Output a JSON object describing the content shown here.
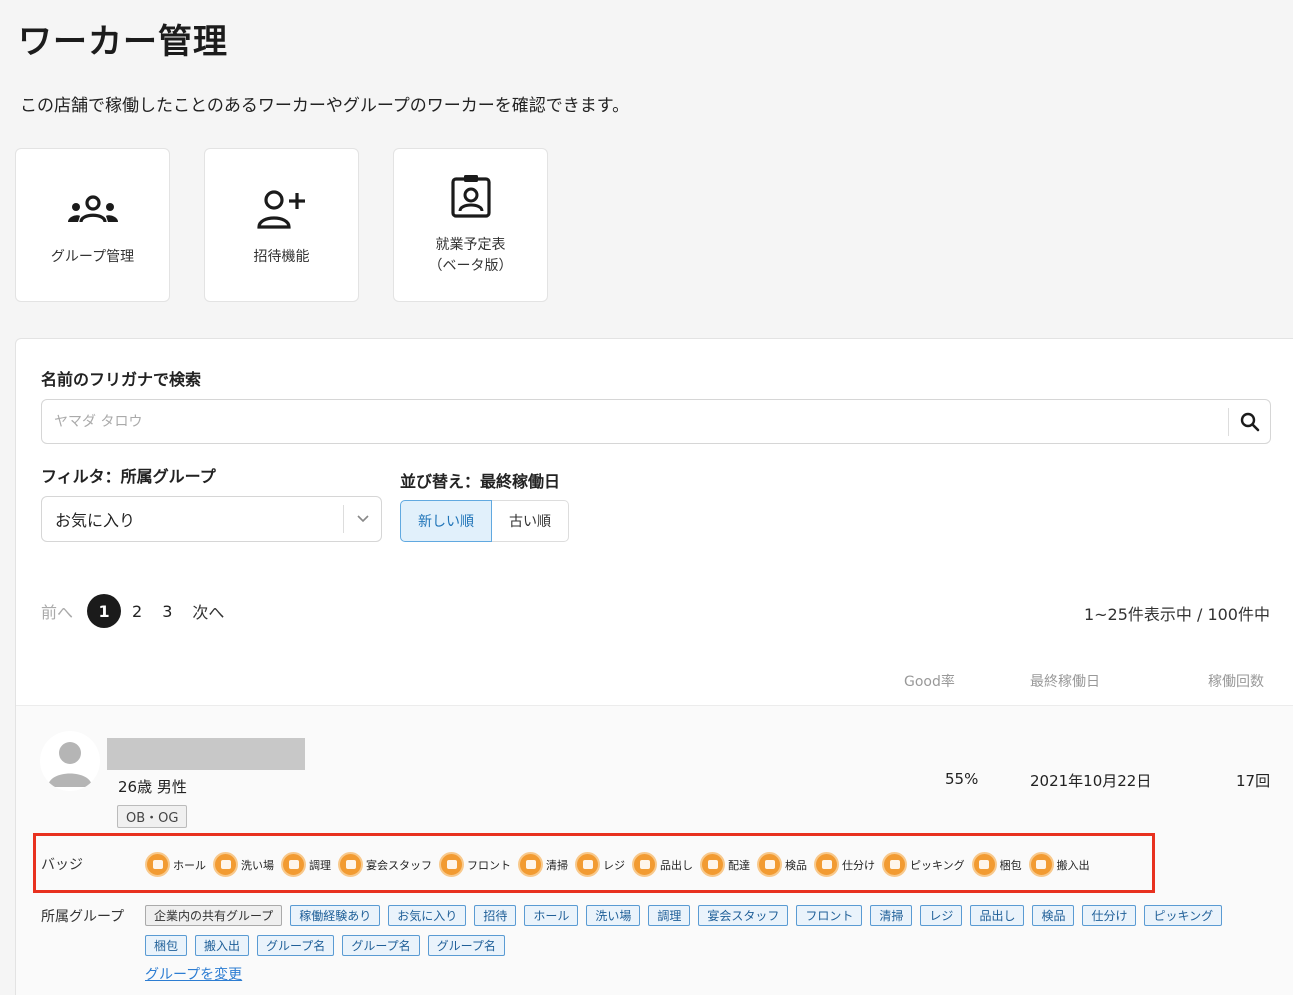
{
  "header": {
    "title": "ワーカー管理",
    "description": "この店舗で稼働したことのあるワーカーやグループのワーカーを確認できます。"
  },
  "cards": [
    {
      "label": "グループ管理",
      "icon": "group-icon"
    },
    {
      "label": "招待機能",
      "icon": "user-plus-icon"
    },
    {
      "label_line1": "就業予定表",
      "label_line2": "（ベータ版）",
      "icon": "id-badge-icon"
    }
  ],
  "search": {
    "label": "名前のフリガナで検索",
    "placeholder": "ヤマダ タロウ",
    "value": ""
  },
  "filter": {
    "label": "フィルタ：所属グループ",
    "selected": "お気に入り"
  },
  "sort": {
    "label": "並び替え：最終稼働日",
    "newest": "新しい順",
    "oldest": "古い順",
    "active": "newest"
  },
  "pagination": {
    "prev": "前へ",
    "pages": [
      "1",
      "2",
      "3"
    ],
    "current": "1",
    "next": "次へ",
    "count_text": "1~25件表示中 / 100件中"
  },
  "columns": {
    "good_rate": "Good率",
    "last_worked": "最終稼働日",
    "work_count": "稼働回数"
  },
  "worker": {
    "age_gender": "26歳 男性",
    "tag": "OB・OG",
    "good_rate": "55%",
    "last_worked": "2021年10月22日",
    "work_count": "17回",
    "badge_label": "バッジ",
    "badges": [
      "ホール",
      "洗い場",
      "調理",
      "宴会スタッフ",
      "フロント",
      "清掃",
      "レジ",
      "品出し",
      "配達",
      "検品",
      "仕分け",
      "ピッキング",
      "梱包",
      "搬入出"
    ],
    "group_label": "所属グループ",
    "groups": [
      "企業内の共有グループ",
      "稼働経験あり",
      "お気に入り",
      "招待",
      "ホール",
      "洗い場",
      "調理",
      "宴会スタッフ",
      "フロント",
      "清掃",
      "レジ",
      "品出し",
      "検品",
      "仕分け",
      "ピッキング",
      "梱包",
      "搬入出",
      "グループ名",
      "グループ名",
      "グループ名"
    ],
    "change_group_link": "グループを変更"
  },
  "colors": {
    "badge_orange": "#f29b32",
    "highlight_red": "#e8311f",
    "link_blue": "#2d7dd2",
    "sort_active_bg": "#e1f0fb"
  }
}
